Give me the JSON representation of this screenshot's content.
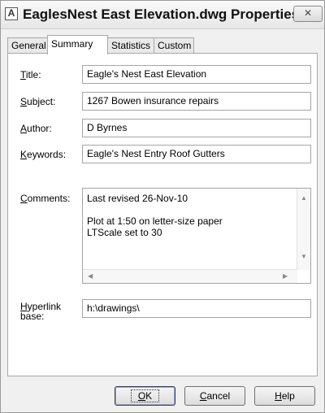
{
  "window": {
    "title": "EaglesNest East Elevation.dwg Properties",
    "close_glyph": "✕"
  },
  "tabs": [
    {
      "label": "General"
    },
    {
      "label": "Summary",
      "active": true
    },
    {
      "label": "Statistics"
    },
    {
      "label": "Custom"
    }
  ],
  "fields": {
    "title": {
      "label_mnemonic": "T",
      "label_rest": "itle:",
      "value": "Eagle's Nest East Elevation"
    },
    "subject": {
      "label_mnemonic": "S",
      "label_rest": "ubject:",
      "value": "1267 Bowen insurance repairs"
    },
    "author": {
      "label_mnemonic": "A",
      "label_rest": "uthor:",
      "value": "D Byrnes"
    },
    "keywords": {
      "label_mnemonic": "K",
      "label_rest": "eywords:",
      "value": "Eagle's Nest Entry Roof Gutters"
    },
    "comments": {
      "label_mnemonic": "C",
      "label_rest": "omments:",
      "value": "Last revised 26-Nov-10\n\nPlot at 1:50 on letter-size paper\nLTScale set to 30"
    },
    "hyperlink": {
      "label_mnemonic": "H",
      "label_line1_rest": "yperlink",
      "label_line2": "base:",
      "value": "h:\\drawings\\"
    }
  },
  "buttons": {
    "ok": {
      "mnemonic": "O",
      "rest": "K"
    },
    "cancel": {
      "mnemonic": "C",
      "rest": "ancel"
    },
    "help": {
      "mnemonic": "H",
      "rest": "elp"
    }
  },
  "icons": {
    "app": "autocad-app-icon",
    "close": "close-icon",
    "scroll_up": "▲",
    "scroll_down": "▼",
    "scroll_left": "◀",
    "scroll_right": "▶"
  }
}
